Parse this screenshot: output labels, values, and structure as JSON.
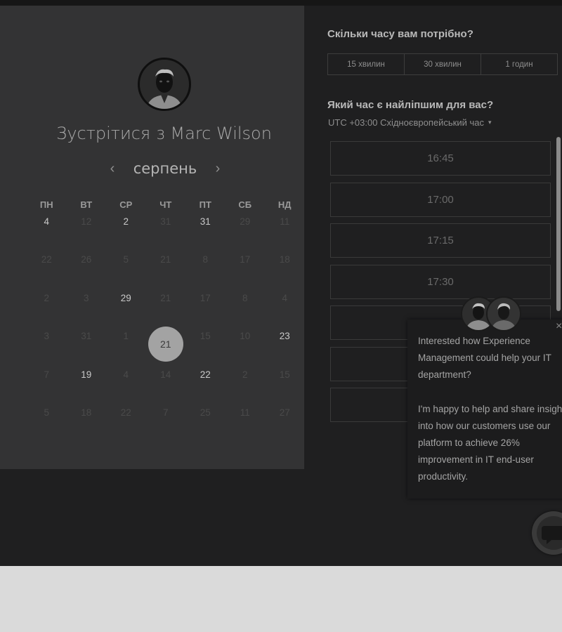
{
  "host": {
    "title": "Зустрітися з Marc Wilson"
  },
  "calendar": {
    "month": "серпень",
    "prev_icon": "‹",
    "next_icon": "›",
    "weekdays": [
      "ПН",
      "ВТ",
      "СР",
      "ЧТ",
      "ПТ",
      "СБ",
      "НД"
    ],
    "weeks": [
      [
        {
          "d": "4",
          "s": "avail"
        },
        {
          "d": "12",
          "s": "dim"
        },
        {
          "d": "2",
          "s": "avail"
        },
        {
          "d": "31",
          "s": "dim"
        },
        {
          "d": "31",
          "s": "avail"
        },
        {
          "d": "29",
          "s": "dim"
        },
        {
          "d": "11",
          "s": "dim"
        }
      ],
      [
        {
          "d": "22",
          "s": "dim"
        },
        {
          "d": "26",
          "s": "dim"
        },
        {
          "d": "5",
          "s": "dim"
        },
        {
          "d": "21",
          "s": "dim"
        },
        {
          "d": "8",
          "s": "dim"
        },
        {
          "d": "17",
          "s": "dim"
        },
        {
          "d": "18",
          "s": "dim"
        }
      ],
      [
        {
          "d": "2",
          "s": "dim"
        },
        {
          "d": "3",
          "s": "dim"
        },
        {
          "d": "29",
          "s": "avail"
        },
        {
          "d": "21",
          "s": "dim"
        },
        {
          "d": "17",
          "s": "dim"
        },
        {
          "d": "8",
          "s": "dim"
        },
        {
          "d": "4",
          "s": "dim"
        }
      ],
      [
        {
          "d": "3",
          "s": "dim"
        },
        {
          "d": "31",
          "s": "dim"
        },
        {
          "d": "1",
          "s": "dim"
        },
        {
          "d": "21",
          "s": "sel"
        },
        {
          "d": "15",
          "s": "dim"
        },
        {
          "d": "10",
          "s": "dim"
        },
        {
          "d": "23",
          "s": "avail"
        }
      ],
      [
        {
          "d": "7",
          "s": "dim"
        },
        {
          "d": "19",
          "s": "avail"
        },
        {
          "d": "4",
          "s": "dim"
        },
        {
          "d": "14",
          "s": "dim"
        },
        {
          "d": "22",
          "s": "avail"
        },
        {
          "d": "2",
          "s": "dim"
        },
        {
          "d": "15",
          "s": "dim"
        }
      ],
      [
        {
          "d": "5",
          "s": "dim"
        },
        {
          "d": "18",
          "s": "dim"
        },
        {
          "d": "22",
          "s": "dim"
        },
        {
          "d": "7",
          "s": "dim"
        },
        {
          "d": "25",
          "s": "dim"
        },
        {
          "d": "11",
          "s": "dim"
        },
        {
          "d": "27",
          "s": "dim"
        }
      ]
    ]
  },
  "duration": {
    "question": "Скільки часу вам потрібно?",
    "options": [
      "15 хвилин",
      "30 хвилин",
      "1 годин"
    ]
  },
  "time": {
    "question": "Який час є найліпшим для вас?",
    "timezone": "UTC +03:00 Східноєвропейський час",
    "caret": "▾",
    "slots": [
      "16:45",
      "17:00",
      "17:15",
      "17:30",
      "",
      "",
      ""
    ]
  },
  "chat": {
    "close": "×",
    "paragraph1": "Interested how Experience Management could help your IT department?",
    "paragraph2": "I'm happy to help and share insight into how our customers use our platform to achieve 26% improvement in IT end-user productivity."
  },
  "icons": {
    "avatar": "person-avatar-icon",
    "chat_launcher": "chat-bubble-icon"
  }
}
